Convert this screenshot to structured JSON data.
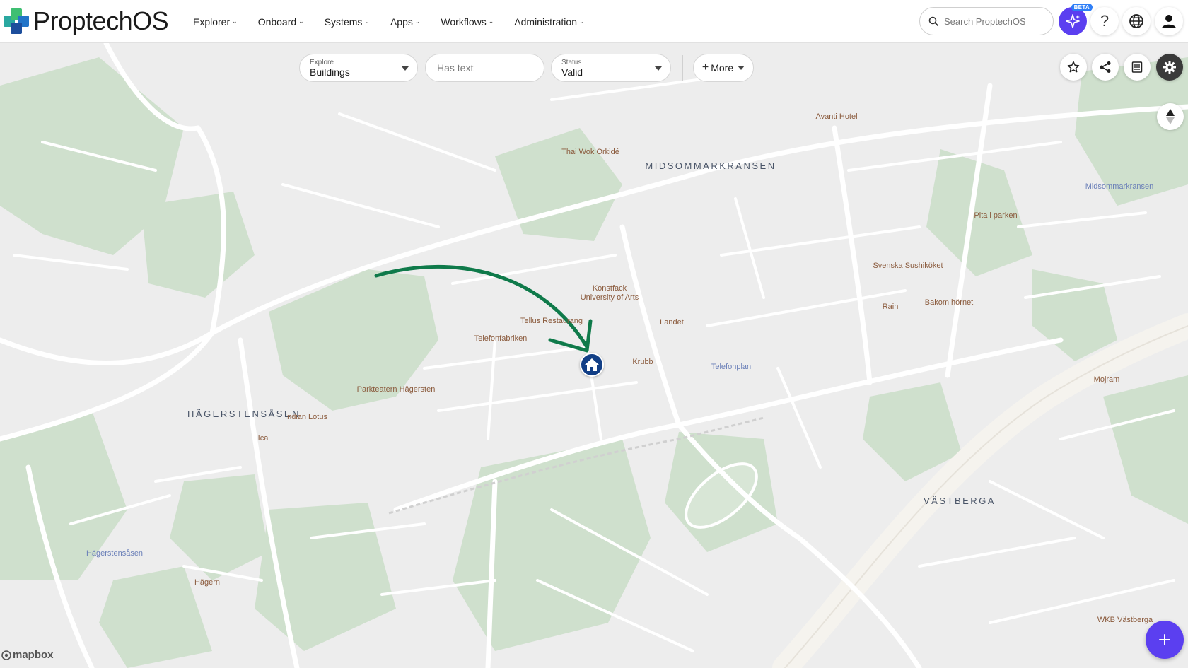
{
  "brand": {
    "name": "ProptechOS"
  },
  "nav": {
    "items": [
      {
        "label": "Explorer"
      },
      {
        "label": "Onboard"
      },
      {
        "label": "Systems"
      },
      {
        "label": "Apps"
      },
      {
        "label": "Workflows"
      },
      {
        "label": "Administration"
      }
    ]
  },
  "search": {
    "placeholder": "Search ProptechOS"
  },
  "header_actions": {
    "beta_badge": "BETA"
  },
  "filters": {
    "explore": {
      "caption": "Explore",
      "value": "Buildings"
    },
    "text": {
      "placeholder": "Has text"
    },
    "status": {
      "caption": "Status",
      "value": "Valid"
    },
    "more_label": "More"
  },
  "map": {
    "attribution": "mapbox",
    "areas": [
      "MIDSOMMARKRANSEN",
      "HÄGERSTENSÅSEN",
      "VÄSTBERGA"
    ],
    "places": [
      "Thai Wok Orkidé",
      "Avanti Hotel",
      "Pita i parken",
      "Svenska Sushiköket",
      "Rain",
      "Bakom hörnet",
      "Konstfack",
      "University of Arts",
      "Landet",
      "Tellus Restaurang",
      "Telefonfabriken",
      "Krubb",
      "Parkteatern Hägersten",
      "Indian Lotus",
      "Ica",
      "Mojram",
      "Hägern",
      "WKB Västberga"
    ],
    "transit": [
      "Midsommarkransen",
      "Telefonplan",
      "Hägerstensåsen"
    ]
  },
  "colors": {
    "accent": "#5b3ff0",
    "marker": "#123f86",
    "arrow": "#0f7a4a",
    "park": "#c9dcc8",
    "road": "#ffffff",
    "land": "#ededed"
  }
}
